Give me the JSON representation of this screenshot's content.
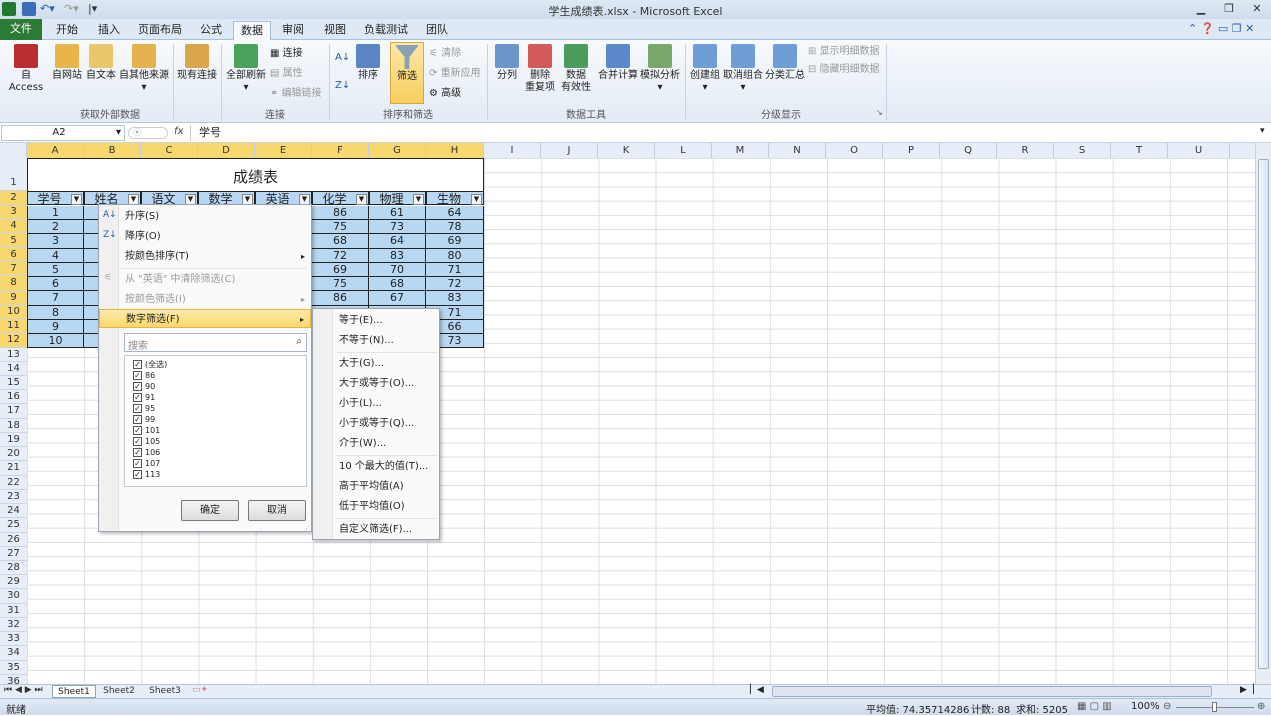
{
  "window": {
    "title": "学生成绩表.xlsx - Microsoft Excel"
  },
  "tabs": [
    "文件",
    "开始",
    "插入",
    "页面布局",
    "公式",
    "数据",
    "审阅",
    "视图",
    "负载测试",
    "团队"
  ],
  "ribbon": {
    "get_external": {
      "label": "获取外部数据",
      "buttons": [
        "自 Access",
        "自网站",
        "自文本",
        "自其他来源",
        "现有连接"
      ]
    },
    "connections": {
      "label": "连接",
      "refresh": "全部刷新",
      "items": [
        "连接",
        "属性",
        "编辑链接"
      ]
    },
    "sort_filter": {
      "label": "排序和筛选",
      "sort": "排序",
      "filter": "筛选",
      "items": [
        "清除",
        "重新应用",
        "高级"
      ]
    },
    "data_tools": {
      "label": "数据工具",
      "buttons": [
        "分列",
        "删除\n重复项",
        "数据\n有效性",
        "合并计算",
        "模拟分析"
      ]
    },
    "outline": {
      "label": "分级显示",
      "buttons": [
        "创建组",
        "取消组合",
        "分类汇总"
      ],
      "items": [
        "显示明细数据",
        "隐藏明细数据"
      ]
    }
  },
  "formula_bar": {
    "name_box": "A2",
    "fx": "fx",
    "content": "学号"
  },
  "columns": [
    "A",
    "B",
    "C",
    "D",
    "E",
    "F",
    "G",
    "H",
    "I",
    "J",
    "K",
    "L",
    "M",
    "N",
    "O",
    "P",
    "Q",
    "R",
    "S",
    "T",
    "U"
  ],
  "rows": [
    "1",
    "2",
    "3",
    "4",
    "5",
    "6",
    "7",
    "8",
    "9",
    "10",
    "11",
    "12",
    "13",
    "14",
    "15",
    "16",
    "17",
    "18",
    "19",
    "20",
    "21",
    "22",
    "23",
    "24",
    "25",
    "26",
    "27",
    "28",
    "29",
    "30",
    "31",
    "32",
    "33",
    "34",
    "35",
    "36"
  ],
  "table": {
    "title": "成绩表",
    "headers": [
      "学号",
      "姓名",
      "语文",
      "数学",
      "英语",
      "化学",
      "物理",
      "生物"
    ],
    "ids": [
      "1",
      "2",
      "3",
      "4",
      "5",
      "6",
      "7",
      "8",
      "9",
      "10"
    ],
    "chem": [
      "86",
      "75",
      "68",
      "72",
      "69",
      "75",
      "86",
      "",
      "",
      ""
    ],
    "phys": [
      "61",
      "73",
      "64",
      "83",
      "70",
      "68",
      "67",
      "",
      "",
      ""
    ],
    "bio": [
      "64",
      "78",
      "69",
      "80",
      "71",
      "72",
      "83",
      "71",
      "66",
      "73"
    ]
  },
  "filter_menu": {
    "items": [
      "升序(S)",
      "降序(O)",
      "按颜色排序(T)",
      "从 \"英语\" 中清除筛选(C)",
      "按颜色筛选(I)",
      "数字筛选(F)"
    ],
    "search_placeholder": "搜索",
    "checks": [
      "(全选)",
      "86",
      "90",
      "91",
      "95",
      "99",
      "101",
      "105",
      "106",
      "107",
      "113"
    ],
    "ok": "确定",
    "cancel": "取消"
  },
  "number_filter_menu": [
    "等于(E)...",
    "不等于(N)...",
    "大于(G)...",
    "大于或等于(O)...",
    "小于(L)...",
    "小于或等于(Q)...",
    "介于(W)...",
    "10 个最大的值(T)...",
    "高于平均值(A)",
    "低于平均值(O)",
    "自定义筛选(F)..."
  ],
  "sheets": [
    "Sheet1",
    "Sheet2",
    "Sheet3"
  ],
  "status": {
    "mode": "就绪",
    "average": "平均值: 74.35714286",
    "count": "计数: 88",
    "sum": "求和: 5205",
    "zoom": "100%"
  }
}
